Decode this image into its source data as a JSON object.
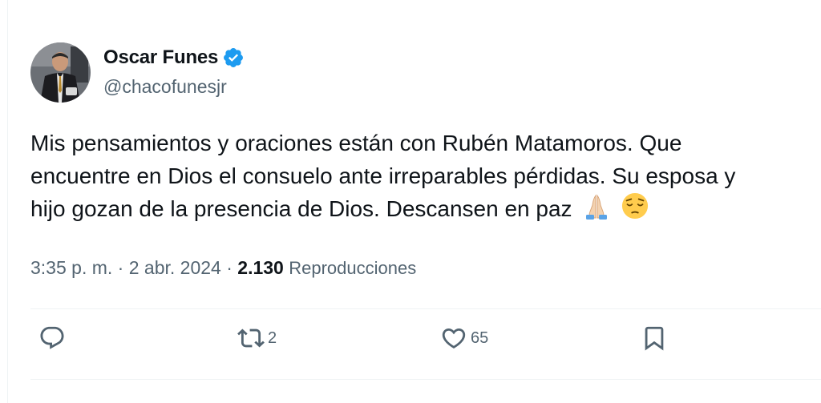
{
  "author": {
    "name": "Oscar Funes",
    "handle": "@chacofunesjr",
    "verified": true,
    "verified_color": "#1d9bf0"
  },
  "tweet": {
    "lines": [
      "Mis pensamientos y oraciones están con Rubén Matamoros. Que",
      "encuentre en Dios el consuelo ante irreparables pérdidas. Su esposa y",
      "hijo gozan de la presencia de Dios. Descansen en paz"
    ],
    "emojis": [
      "folded-hands",
      "pensive-face"
    ]
  },
  "meta": {
    "time": "3:35 p. m.",
    "separator": "·",
    "date": "2 abr. 2024",
    "views_count": "2.130",
    "views_label": "Reproducciones"
  },
  "actions": {
    "reply": {
      "icon": "reply-icon",
      "count": ""
    },
    "retweet": {
      "icon": "retweet-icon",
      "count": "2"
    },
    "like": {
      "icon": "heart-icon",
      "count": "65"
    },
    "bookmark": {
      "icon": "bookmark-icon",
      "count": ""
    }
  },
  "colors": {
    "text_primary": "#0f1419",
    "text_secondary": "#536471",
    "divider": "#eff3f4"
  }
}
